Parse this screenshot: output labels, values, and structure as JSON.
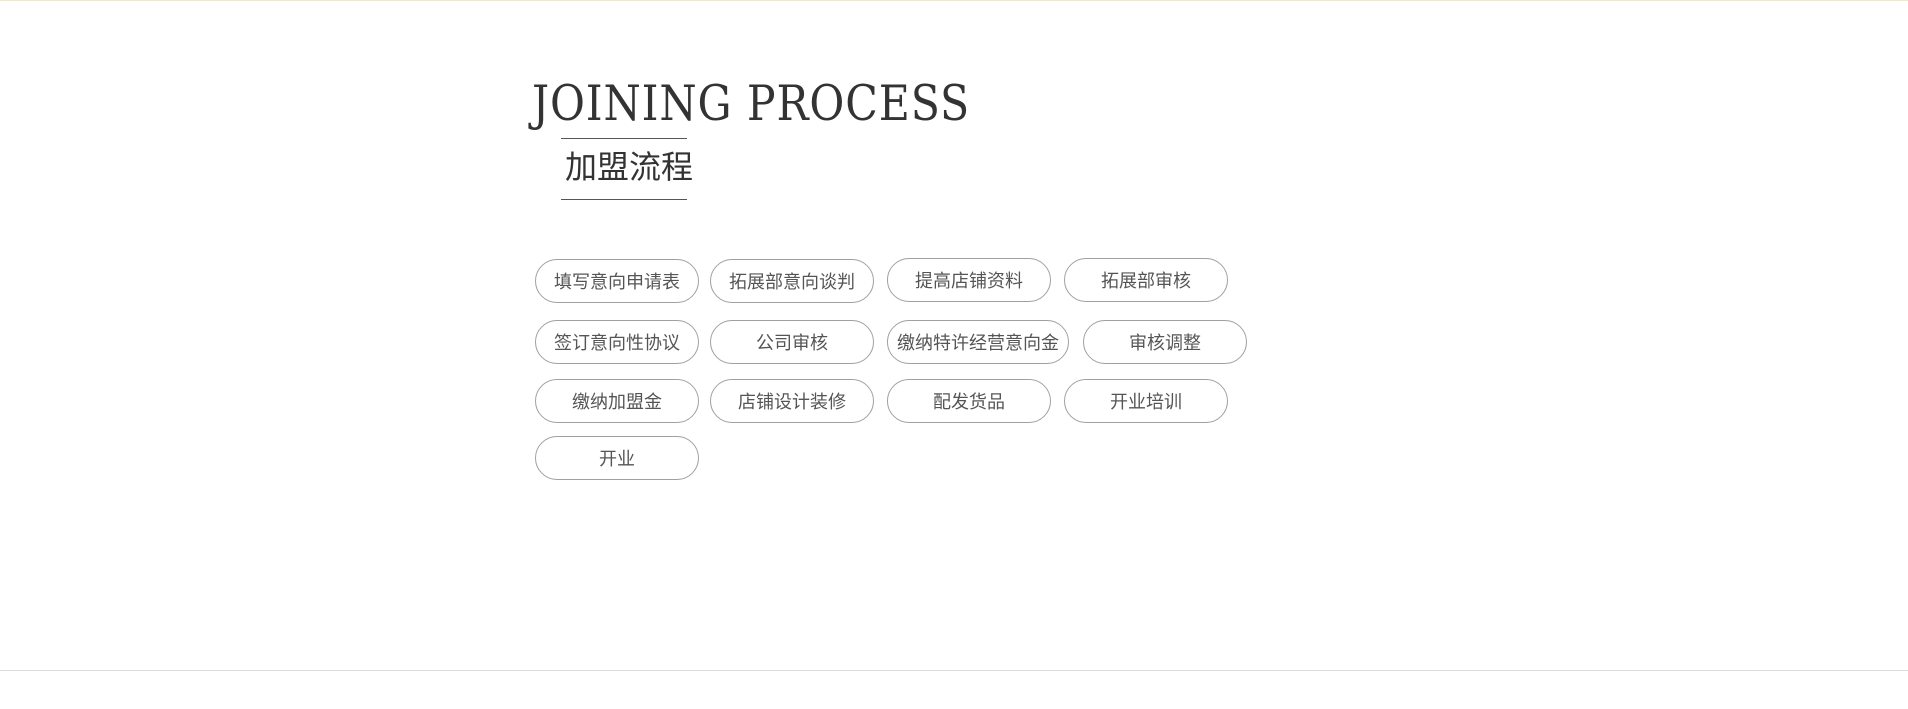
{
  "heading": {
    "en": "JOINING PROCESS",
    "cn": "加盟流程"
  },
  "steps": [
    "填写意向申请表",
    "拓展部意向谈判",
    "提高店铺资料",
    "拓展部审核",
    "签订意向性协议",
    "公司审核",
    "缴纳特许经营意向金",
    "审核调整",
    "缴纳加盟金",
    "店铺设计装修",
    "配发货品",
    "开业培训",
    "开业"
  ]
}
